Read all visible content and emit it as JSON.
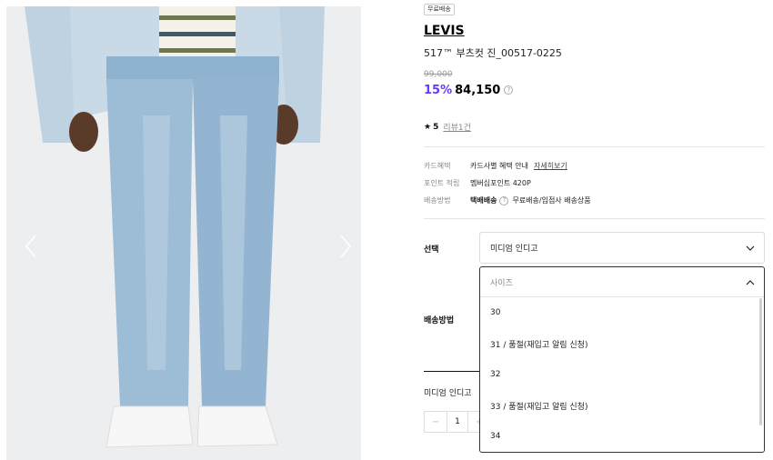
{
  "product": {
    "badge": "무료배송",
    "brand": "LEVIS",
    "name": "517™ 부츠컷 진_00517-0225",
    "original_price": "99,000",
    "discount": "15%",
    "price": "84,150",
    "rating": "5",
    "review_link": "리뷰1건"
  },
  "meta": [
    {
      "label": "카드혜택",
      "value": "카드사별 혜택 안내",
      "link": "자세히보기"
    },
    {
      "label": "포인트 적립",
      "value": "멤버십포인트 420P"
    },
    {
      "label": "배송방법",
      "bold": "택배배송",
      "value": "무료배송/입점사 배송상품"
    }
  ],
  "options": {
    "select_label": "선택",
    "color_value": "미디엄 인디고",
    "shipping_label": "배송방법",
    "size_placeholder": "사이즈",
    "sizes": [
      "30",
      "31 / 품절(재입고 알림 신청)",
      "32",
      "33 / 품절(재입고 알림 신청)",
      "34"
    ]
  },
  "selection": {
    "name": "미디엄 인디고",
    "quantity": "1",
    "minus": "−",
    "plus": "+"
  },
  "icons": {
    "star": "star-icon",
    "info": "info-icon",
    "chevron_down": "chevron-down-icon",
    "chevron_up": "chevron-up-icon",
    "arrow_left": "arrow-left-icon",
    "arrow_right": "arrow-right-icon"
  },
  "colors": {
    "discount": "#6a39ff",
    "text": "#111111",
    "muted": "#888888"
  }
}
